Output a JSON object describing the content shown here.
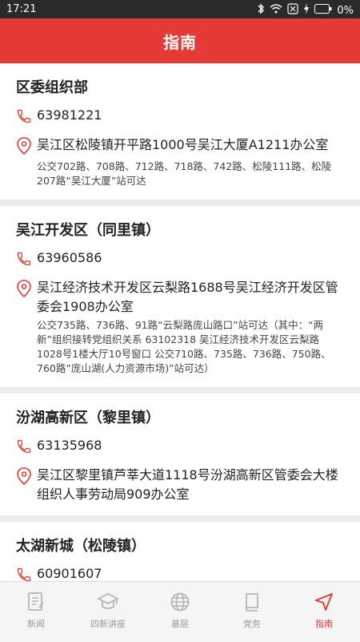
{
  "status": {
    "time": "17:21",
    "battery": "0%"
  },
  "header": {
    "title": "指南"
  },
  "cards": [
    {
      "org": "区委组织部",
      "phone": "63981221",
      "address": "吴江区松陵镇开平路1000号吴江大厦A1211办公室",
      "bus": "公交702路、708路、712路、718路、742路、松陵111路、松陵207路“吴江大厦”站可达"
    },
    {
      "org": "吴江开发区（同里镇）",
      "phone": "63960586",
      "address": "吴江经济技术开发区云梨路1688号吴江经济开发区管委会1908办公室",
      "bus": "公交735路、736路、91路“云梨路庞山路口”站可达（其中：“两新”组织接转党组织关系 63102318 吴江经济技术开发区云梨路1028号1楼大厅10号窗口 公交710路、735路、736路、750路、760路”庞山湖(人力资源市场)”站可达）"
    },
    {
      "org": "汾湖高新区（黎里镇）",
      "phone": "63135968",
      "address": "吴江区黎里镇芦莘大道1118号汾湖高新区管委会大楼组织人事劳动局909办公室",
      "bus": ""
    },
    {
      "org": "太湖新城（松陵镇）",
      "phone": "60901607",
      "address": "",
      "bus": ""
    }
  ],
  "tabs": [
    {
      "label": "新闻",
      "icon": "news-icon"
    },
    {
      "label": "四新讲座",
      "icon": "graduation-cap-icon"
    },
    {
      "label": "基层",
      "icon": "globe-icon"
    },
    {
      "label": "党务",
      "icon": "book-icon"
    },
    {
      "label": "指南",
      "icon": "navigation-arrow-icon",
      "active": true
    }
  ],
  "colors": {
    "brand": "#e53a35",
    "inactive": "#999999"
  }
}
